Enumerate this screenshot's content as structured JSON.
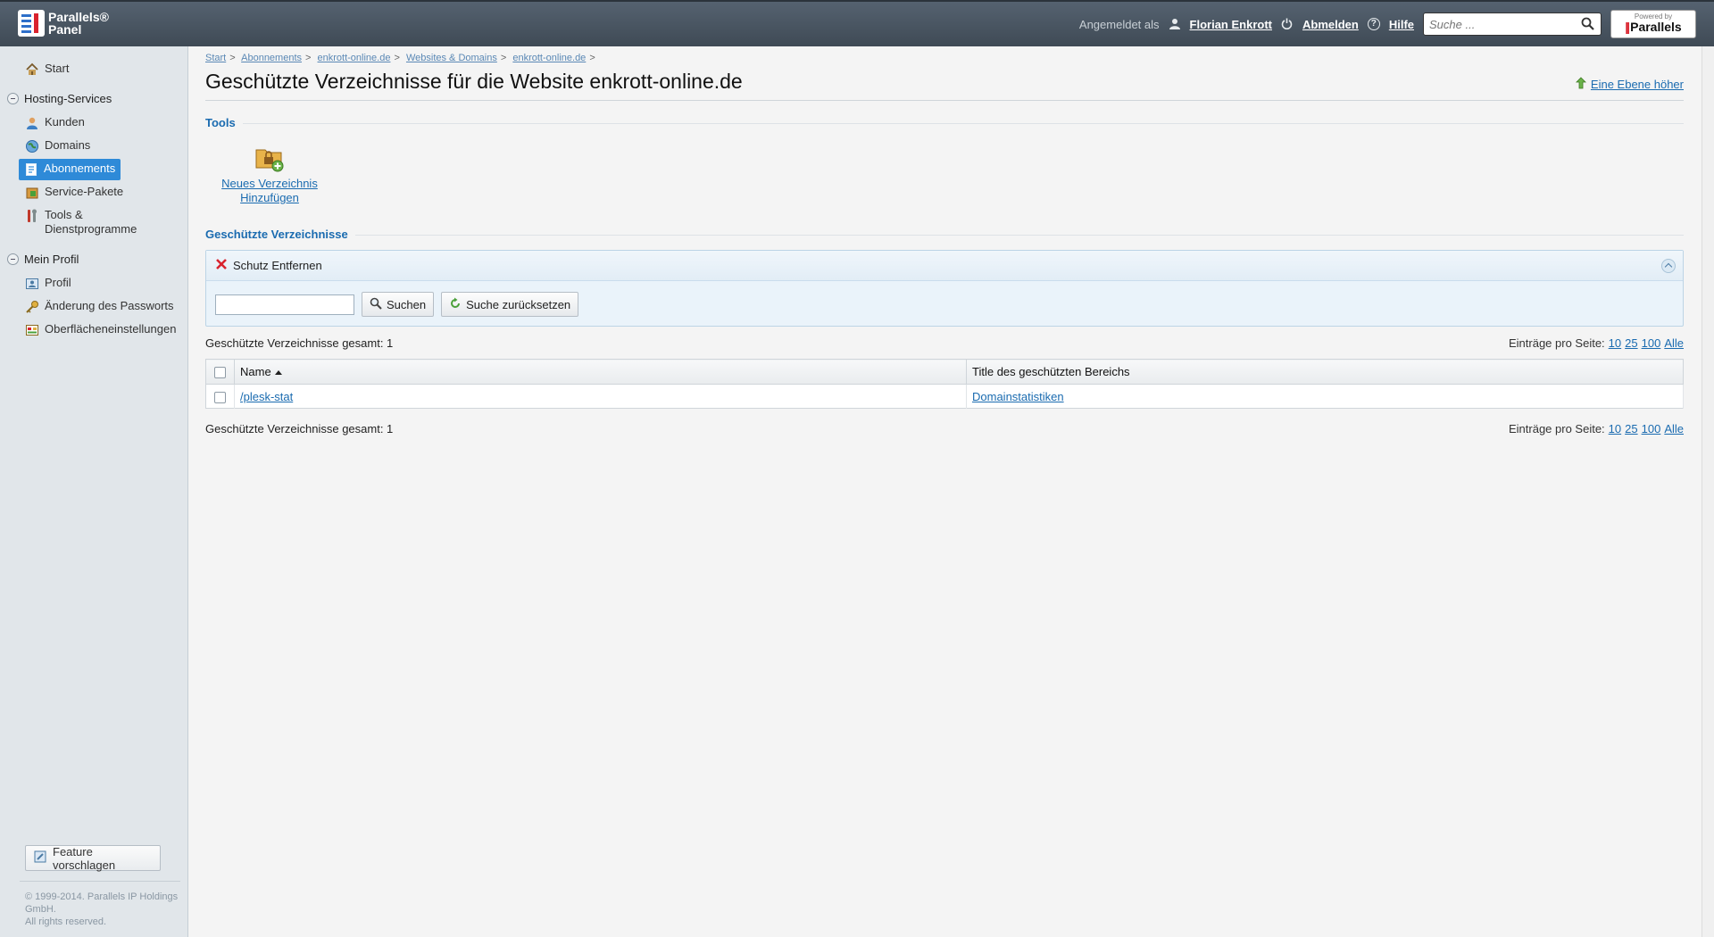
{
  "header": {
    "logo_line1": "Parallels®",
    "logo_line2": "Panel",
    "logged_in_label": "Angemeldet als",
    "user_name": "Florian Enkrott",
    "logout_label": "Abmelden",
    "help_label": "Hilfe",
    "search_placeholder": "Suche ...",
    "powered_by_small": "Powered by",
    "powered_by_brand": "Parallels"
  },
  "sidebar": {
    "start": "Start",
    "groups": [
      {
        "label": "Hosting-Services",
        "items": [
          {
            "label": "Kunden",
            "icon": "user-icon"
          },
          {
            "label": "Domains",
            "icon": "globe-icon"
          },
          {
            "label": "Abonnements",
            "icon": "subscription-icon",
            "active": true
          },
          {
            "label": "Service-Pakete",
            "icon": "package-icon"
          },
          {
            "label": "Tools &",
            "label2": "Dienstprogramme",
            "icon": "tools-icon"
          }
        ]
      },
      {
        "label": "Mein Profil",
        "items": [
          {
            "label": "Profil",
            "icon": "profile-icon"
          },
          {
            "label": "Änderung des Passworts",
            "icon": "key-icon"
          },
          {
            "label": "Oberflächeneinstellungen",
            "icon": "interface-settings-icon"
          }
        ]
      }
    ],
    "feature_button": "Feature vorschlagen",
    "copyright_line1": "© 1999-2014. Parallels IP Holdings",
    "copyright_line2": "GmbH.",
    "copyright_line3": "All rights reserved."
  },
  "breadcrumb": [
    "Start",
    "Abonnements",
    "enkrott-online.de",
    "Websites & Domains",
    "enkrott-online.de"
  ],
  "breadcrumb_sep": ">",
  "page": {
    "title": "Geschützte Verzeichnisse für die Website enkrott-online.de",
    "up_link": "Eine Ebene höher",
    "tools_title": "Tools",
    "tool_new_line1": "Neues Verzeichnis",
    "tool_new_line2": "Hinzufügen",
    "list_title": "Geschützte Verzeichnisse",
    "remove_button": "Schutz Entfernen",
    "search_button": "Suchen",
    "reset_button": "Suche zurücksetzen",
    "search_value": "",
    "total_text": "Geschützte Verzeichnisse gesamt: 1",
    "per_page_label": "Einträge pro Seite:",
    "per_page_options": [
      "10",
      "25",
      "100",
      "Alle"
    ]
  },
  "table": {
    "columns": [
      "Name",
      "Title des geschützten Bereichs"
    ],
    "rows": [
      {
        "name": "/plesk-stat",
        "title": "Domainstatistiken"
      }
    ]
  },
  "colors": {
    "header_bg": "#4a5561",
    "sidebar_bg": "#e1e6ea",
    "active_item": "#2e8ad8",
    "link": "#1a6bb0"
  }
}
